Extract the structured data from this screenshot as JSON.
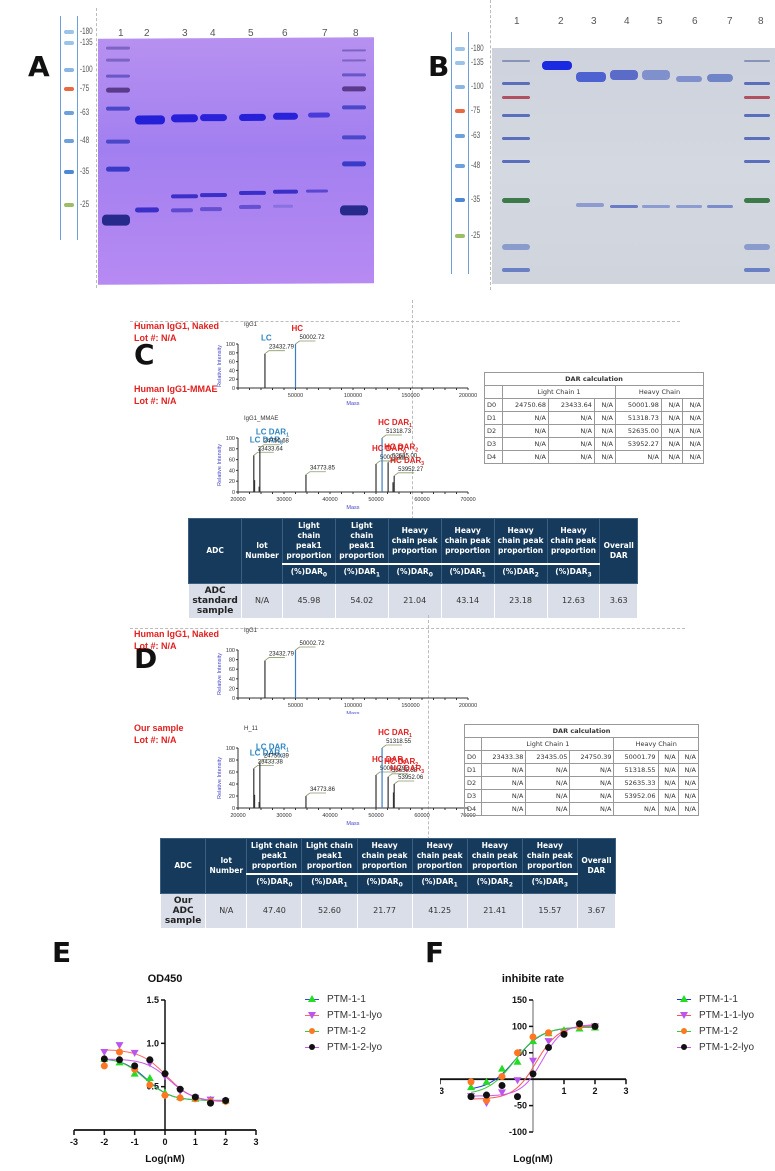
{
  "panels": {
    "A": {
      "letter": "A",
      "marker_labels": [
        "180",
        "135",
        "100",
        "75",
        "63",
        "48",
        "35",
        "25"
      ],
      "lane_numbers": [
        "1",
        "2",
        "3",
        "4",
        "5",
        "6",
        "7",
        "8"
      ]
    },
    "B": {
      "letter": "B",
      "marker_labels": [
        "180",
        "135",
        "100",
        "75",
        "63",
        "48",
        "35",
        "25"
      ],
      "lane_numbers": [
        "1",
        "2",
        "3",
        "4",
        "5",
        "6",
        "7",
        "8"
      ]
    },
    "C": {
      "letter": "C",
      "naked_title": "Human IgG1, Naked",
      "naked_lot": "Lot #: N/A",
      "adc_title": "Human IgG1-MMAE",
      "adc_lot": "Lot #: N/A",
      "dar_table": {
        "title": "DAR calculation",
        "group_headers": [
          "Light Chain 1",
          "Heavy Chain"
        ],
        "rows": [
          [
            "D0",
            "24750.68",
            "23433.64",
            "N/A",
            "50001.98",
            "N/A",
            "N/A"
          ],
          [
            "D1",
            "N/A",
            "N/A",
            "N/A",
            "51318.73",
            "N/A",
            "N/A"
          ],
          [
            "D2",
            "N/A",
            "N/A",
            "N/A",
            "52635.00",
            "N/A",
            "N/A"
          ],
          [
            "D3",
            "N/A",
            "N/A",
            "N/A",
            "53952.27",
            "N/A",
            "N/A"
          ],
          [
            "D4",
            "N/A",
            "N/A",
            "N/A",
            "N/A",
            "N/A",
            "N/A"
          ]
        ]
      },
      "summary": {
        "headers": [
          "ADC",
          "lot Number",
          "Light chain peak1 proportion",
          "Light chain peak1 proportion",
          "Heavy chain peak proportion",
          "Heavy chain peak proportion",
          "Heavy chain peak proportion",
          "Heavy chain peak proportion",
          "Overall DAR"
        ],
        "subheaders": [
          "(%)DAR",
          "(%)DAR",
          "(%)DAR",
          "(%)DAR",
          "(%)DAR",
          "(%)DAR"
        ],
        "subscripts": [
          "0",
          "1",
          "0",
          "1",
          "2",
          "3"
        ],
        "row": [
          "ADC standard sample",
          "N/A",
          "45.98",
          "54.02",
          "21.04",
          "43.14",
          "23.18",
          "12.63",
          "3.63"
        ]
      }
    },
    "D": {
      "letter": "D",
      "naked_title": "Human IgG1, Naked",
      "naked_lot": "Lot #: N/A",
      "adc_title": "Our sample",
      "adc_lot": "Lot #: N/A",
      "dar_table": {
        "title": "DAR calculation",
        "group_headers": [
          "Light Chain 1",
          "Heavy Chain"
        ],
        "rows": [
          [
            "D0",
            "23433.38",
            "23435.05",
            "24750.39",
            "50001.79",
            "N/A",
            "N/A"
          ],
          [
            "D1",
            "N/A",
            "N/A",
            "N/A",
            "51318.55",
            "N/A",
            "N/A"
          ],
          [
            "D2",
            "N/A",
            "N/A",
            "N/A",
            "52635.33",
            "N/A",
            "N/A"
          ],
          [
            "D3",
            "N/A",
            "N/A",
            "N/A",
            "53952.06",
            "N/A",
            "N/A"
          ],
          [
            "D4",
            "N/A",
            "N/A",
            "N/A",
            "N/A",
            "N/A",
            "N/A"
          ]
        ]
      },
      "summary": {
        "headers": [
          "ADC",
          "lot Number",
          "Light chain peak1 proportion",
          "Light chain peak1 proportion",
          "Heavy chain peak proportion",
          "Heavy chain peak proportion",
          "Heavy chain peak proportion",
          "Heavy chain peak proportion",
          "Overall DAR"
        ],
        "subheaders": [
          "(%)DAR",
          "(%)DAR",
          "(%)DAR",
          "(%)DAR",
          "(%)DAR",
          "(%)DAR"
        ],
        "subscripts": [
          "0",
          "1",
          "0",
          "1",
          "2",
          "3"
        ],
        "row": [
          "Our ADC sample",
          "N/A",
          "47.40",
          "52.60",
          "21.77",
          "41.25",
          "21.41",
          "15.57",
          "3.67"
        ]
      }
    },
    "E": {
      "letter": "E"
    },
    "F": {
      "letter": "F"
    }
  },
  "chart_data": [
    {
      "id": "C-naked",
      "type": "bar",
      "title": "IgG1",
      "xlabel": "Mass",
      "ylabel": "Relative Intensity",
      "xlim": [
        0,
        200000
      ],
      "ylim": [
        0,
        100
      ],
      "xticks": [
        50000,
        100000,
        150000,
        200000
      ],
      "yticks": [
        0,
        20,
        40,
        60,
        80,
        100
      ],
      "peaks": [
        {
          "x": 23432.79,
          "y": 78,
          "label": "23432.79",
          "color": "#333333",
          "tag": "LC",
          "tag_color": "#2e86c1"
        },
        {
          "x": 50002.72,
          "y": 100,
          "label": "50002.72",
          "color": "#3a7fc1",
          "tag": "HC",
          "tag_color": "#e32020"
        }
      ]
    },
    {
      "id": "C-adc",
      "type": "bar",
      "title": "IgG1_MMAE",
      "xlabel": "Mass",
      "ylabel": "Relative Intensity",
      "xlim": [
        20000,
        70000
      ],
      "ylim": [
        0,
        100
      ],
      "xticks": [
        20000,
        30000,
        40000,
        50000,
        60000,
        70000
      ],
      "yticks": [
        0,
        20,
        40,
        60,
        80,
        100
      ],
      "peaks": [
        {
          "x": 23433.64,
          "y": 68,
          "label": "23433.64",
          "color": "#333333",
          "tag": "LC DAR0",
          "tag_color": "#2e86c1"
        },
        {
          "x": 23600,
          "y": 22,
          "label": "",
          "color": "#333333"
        },
        {
          "x": 24750.68,
          "y": 82,
          "label": "24750.68",
          "color": "#333333",
          "tag": "LC DAR1",
          "tag_color": "#2e86c1"
        },
        {
          "x": 24600,
          "y": 10,
          "label": "",
          "color": "#333333"
        },
        {
          "x": 34773.85,
          "y": 32,
          "label": "34773.85",
          "color": "#333333"
        },
        {
          "x": 50001.98,
          "y": 52,
          "label": "50001.98",
          "color": "#333333",
          "tag": "HC DAR0",
          "tag_color": "#e32020"
        },
        {
          "x": 51318.73,
          "y": 100,
          "label": "51318.73",
          "color": "#3a7fc1",
          "tag": "HC DAR1",
          "tag_color": "#e32020"
        },
        {
          "x": 52635.0,
          "y": 55,
          "label": "52635.00",
          "color": "#333333",
          "tag": "HC DAR2",
          "tag_color": "#e32020"
        },
        {
          "x": 53952.27,
          "y": 30,
          "label": "53952.27",
          "color": "#333333",
          "tag": "HC DAR3",
          "tag_color": "#e32020"
        },
        {
          "x": 53700,
          "y": 18,
          "label": "",
          "color": "#333333"
        }
      ]
    },
    {
      "id": "D-naked",
      "type": "bar",
      "title": "IgG1",
      "xlabel": "Mass",
      "ylabel": "Relative Intensity",
      "xlim": [
        0,
        200000
      ],
      "ylim": [
        0,
        100
      ],
      "xticks": [
        50000,
        100000,
        150000,
        200000
      ],
      "yticks": [
        0,
        20,
        40,
        60,
        80,
        100
      ],
      "peaks": [
        {
          "x": 23432.79,
          "y": 78,
          "label": "23432.79",
          "color": "#333333"
        },
        {
          "x": 50002.72,
          "y": 100,
          "label": "50002.72",
          "color": "#3a7fc1"
        }
      ]
    },
    {
      "id": "D-adc",
      "type": "bar",
      "title": "H_11",
      "xlabel": "Mass",
      "ylabel": "Relative Intensity",
      "xlim": [
        20000,
        70000
      ],
      "ylim": [
        0,
        100
      ],
      "xticks": [
        20000,
        30000,
        40000,
        50000,
        60000,
        70000
      ],
      "yticks": [
        0,
        20,
        40,
        60,
        80,
        100
      ],
      "peaks": [
        {
          "x": 23433.38,
          "y": 66,
          "label": "23433.38",
          "color": "#333333",
          "tag": "LC DAR0",
          "tag_color": "#2e86c1"
        },
        {
          "x": 23600,
          "y": 22,
          "label": "",
          "color": "#333333"
        },
        {
          "x": 24750.39,
          "y": 76,
          "label": "24750.39",
          "color": "#333333",
          "tag": "LC DAR1",
          "tag_color": "#2e86c1"
        },
        {
          "x": 24600,
          "y": 10,
          "label": "",
          "color": "#333333"
        },
        {
          "x": 34773.86,
          "y": 20,
          "label": "34773.86",
          "color": "#333333"
        },
        {
          "x": 50001.79,
          "y": 55,
          "label": "50001.79",
          "color": "#333333",
          "tag": "HC DAR0",
          "tag_color": "#e32020"
        },
        {
          "x": 51318.55,
          "y": 100,
          "label": "51318.55",
          "color": "#3a7fc1",
          "tag": "HC DAR1",
          "tag_color": "#e32020"
        },
        {
          "x": 52635.33,
          "y": 52,
          "label": "52635.33",
          "color": "#333333",
          "tag": "HC DAR2",
          "tag_color": "#e32020"
        },
        {
          "x": 53952.06,
          "y": 40,
          "label": "53952.06",
          "color": "#333333",
          "tag": "HC DAR3",
          "tag_color": "#e32020"
        },
        {
          "x": 53800,
          "y": 26,
          "label": "",
          "color": "#333333"
        }
      ]
    },
    {
      "id": "E",
      "type": "scatter",
      "title": "OD450",
      "xlabel": "Log(nM)",
      "ylabel": "",
      "xlim": [
        -3,
        3
      ],
      "ylim": [
        0,
        1.5
      ],
      "xticks": [
        -3,
        -2,
        -1,
        0,
        1,
        2,
        3
      ],
      "yticks": [
        0.5,
        1.0,
        1.5
      ],
      "ytick_labels": [
        "0.5",
        "1.0",
        "1.5"
      ],
      "legend_position": "right",
      "series": [
        {
          "name": "PTM-1-1",
          "marker": "triangle-up",
          "marker_color": "#22dd22",
          "line_color": "#3344dd",
          "x": [
            -2,
            -1.5,
            -1,
            -0.5,
            0,
            0.5,
            1,
            1.5,
            2
          ],
          "y": [
            0.82,
            0.78,
            0.65,
            0.6,
            0.43,
            0.38,
            0.36,
            0.35,
            0.34
          ],
          "fit": {
            "bottom": 0.34,
            "top": 0.83,
            "logec50": -0.6,
            "hill": -1.1
          }
        },
        {
          "name": "PTM-1-1-lyo",
          "marker": "triangle-down",
          "marker_color": "#bb55ee",
          "line_color": "#ff6666",
          "x": [
            -2,
            -1.5,
            -1,
            -0.5,
            0,
            0.5,
            1,
            1.5,
            2
          ],
          "y": [
            0.9,
            0.98,
            0.89,
            0.77,
            0.62,
            0.45,
            0.37,
            0.35,
            0.33
          ],
          "fit": {
            "bottom": 0.32,
            "top": 0.93,
            "logec50": 0.05,
            "hill": -1.0
          }
        },
        {
          "name": "PTM-1-2",
          "marker": "circle",
          "marker_color": "#ff7722",
          "line_color": "#33cc33",
          "x": [
            -2,
            -1.5,
            -1,
            -0.5,
            0,
            0.5,
            1,
            1.5,
            2
          ],
          "y": [
            0.74,
            0.9,
            0.7,
            0.52,
            0.4,
            0.37,
            0.36,
            0.33,
            0.33
          ],
          "fit": {
            "bottom": 0.34,
            "top": 0.84,
            "logec50": -0.65,
            "hill": -1.05
          }
        },
        {
          "name": "PTM-1-2-lyo",
          "marker": "circle",
          "marker_color": "#111111",
          "line_color": "#cc55ee",
          "x": [
            -2,
            -1.5,
            -1,
            -0.5,
            0,
            0.5,
            1,
            1.5,
            2
          ],
          "y": [
            0.82,
            0.81,
            0.74,
            0.81,
            0.65,
            0.47,
            0.38,
            0.31,
            0.34
          ],
          "fit": {
            "bottom": 0.33,
            "top": 0.82,
            "logec50": 0.15,
            "hill": -1.1
          }
        }
      ]
    },
    {
      "id": "F",
      "type": "scatter",
      "title": "inhibite rate",
      "xlabel": "Log(nM)",
      "ylabel": "",
      "xlim": [
        -3,
        3
      ],
      "ylim": [
        -100,
        150
      ],
      "xticks": [
        -3,
        1,
        2,
        3
      ],
      "xtick_labels": [
        "-3",
        "1",
        "2",
        "3"
      ],
      "yticks": [
        -100,
        -50,
        50,
        100,
        150
      ],
      "ytick_labels": [
        "-100",
        "-50",
        "50",
        "100",
        "150"
      ],
      "legend_position": "right",
      "series": [
        {
          "name": "PTM-1-1",
          "marker": "triangle-up",
          "marker_color": "#22dd22",
          "line_color": "#2233dd",
          "x": [
            -2,
            -1.5,
            -1,
            -0.5,
            0,
            0.5,
            1,
            1.5,
            2
          ],
          "y": [
            -15,
            -5,
            20,
            33,
            72,
            87,
            93,
            96,
            98
          ],
          "fit": {
            "bottom": -22,
            "top": 99,
            "logec50": -0.55,
            "hill": 1.0
          }
        },
        {
          "name": "PTM-1-1-lyo",
          "marker": "triangle-down",
          "marker_color": "#bb55ee",
          "line_color": "#ff5555",
          "x": [
            -2,
            -1.5,
            -1,
            -0.5,
            0,
            0.5,
            1,
            1.5,
            2
          ],
          "y": [
            -32,
            -45,
            -25,
            -2,
            35,
            72,
            88,
            100,
            100
          ],
          "fit": {
            "bottom": -38,
            "top": 102,
            "logec50": 0.1,
            "hill": 1.2
          }
        },
        {
          "name": "PTM-1-2",
          "marker": "circle",
          "marker_color": "#ff7722",
          "line_color": "#33cc33",
          "x": [
            -2,
            -1.5,
            -1,
            -0.5,
            0,
            0.5,
            1,
            1.5,
            2
          ],
          "y": [
            -5,
            -40,
            5,
            50,
            80,
            88,
            88,
            100,
            100
          ],
          "fit": {
            "bottom": -30,
            "top": 99,
            "logec50": -0.6,
            "hill": 1.0
          }
        },
        {
          "name": "PTM-1-2-lyo",
          "marker": "circle",
          "marker_color": "#111111",
          "line_color": "#cc55ee",
          "x": [
            -2,
            -1.5,
            -1,
            -0.5,
            0,
            0.5,
            1,
            1.5,
            2
          ],
          "y": [
            -33,
            -30,
            -12,
            -33,
            10,
            60,
            85,
            105,
            100
          ],
          "fit": {
            "bottom": -32,
            "top": 104,
            "logec50": 0.3,
            "hill": 1.3
          }
        }
      ]
    }
  ]
}
